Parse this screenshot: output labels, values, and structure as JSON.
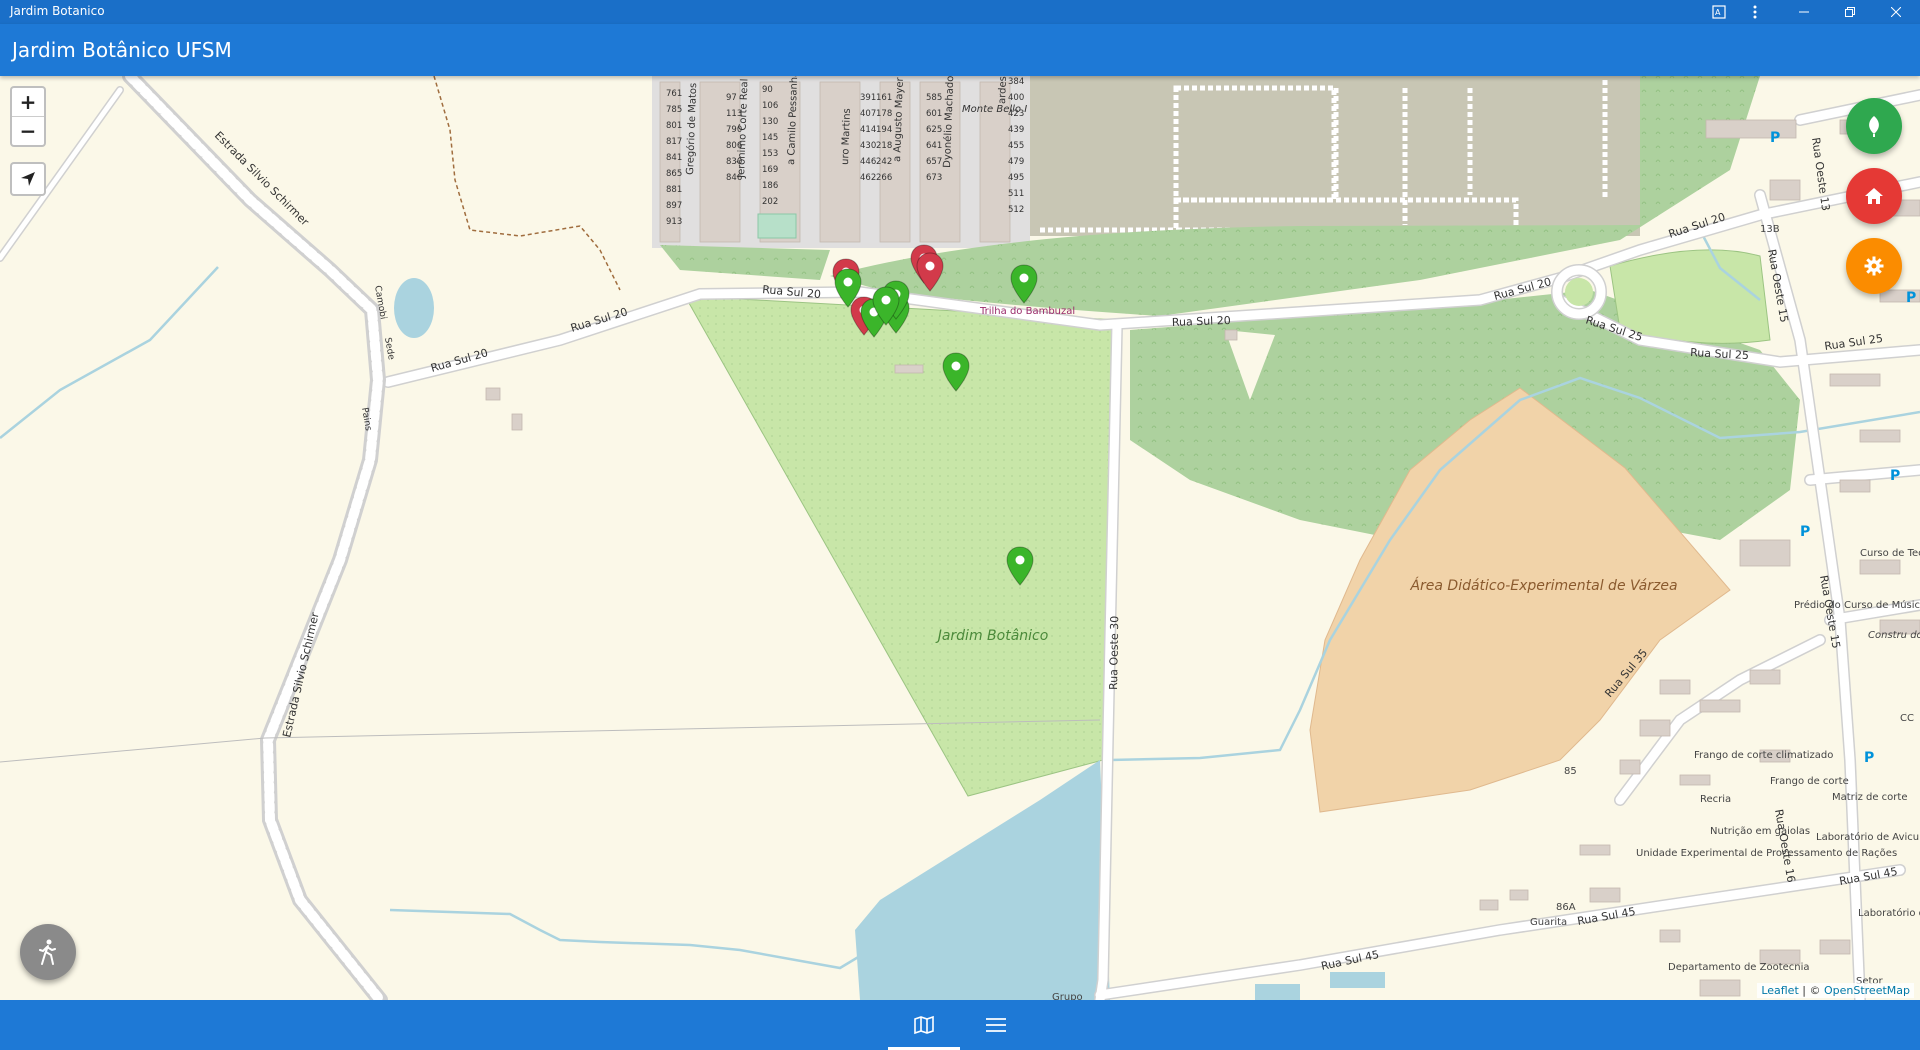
{
  "window": {
    "title": "Jardim Botanico",
    "buttons": [
      "translate-icon",
      "more-icon",
      "minimize-icon",
      "restore-icon",
      "close-icon"
    ]
  },
  "appbar": {
    "title": "Jardim Botânico UFSM"
  },
  "map": {
    "zoom_in": "+",
    "zoom_out": "−",
    "streets": {
      "rua_sul_20_a": "Rua Sul 20",
      "rua_sul_20_b": "Rua Sul 20",
      "rua_sul_20_c": "Rua Sul 20",
      "rua_sul_20_d": "Rua Sul 20",
      "rua_sul_20_e": "Rua Sul 20",
      "rua_sul_20_f": "Rua Sul 20",
      "rua_sul_25_a": "Rua Sul 25",
      "rua_sul_25_b": "Rua Sul 25",
      "rua_sul_25_c": "Rua Sul 25",
      "rua_sul_35": "Rua Sul 35",
      "rua_sul_45_a": "Rua Sul 45",
      "rua_sul_45_b": "Rua Sul 45",
      "rua_sul_45_c": "Rua Sul 45",
      "rua_oeste_30": "Rua Oeste 30",
      "rua_oeste_15_a": "Rua Oeste 15",
      "rua_oeste_15_b": "Rua Oeste 15",
      "rua_oeste_16": "Rua Oeste 16",
      "rua_oeste_13": "Rua Oeste 13",
      "estrada_a": "Estrada Silvio Schirmer",
      "estrada_b": "Estrada Silvio Schirmer",
      "camobi": "Camobi",
      "sede": "Sede",
      "pains": "Pains",
      "gregorio": "Gregório de Matos",
      "jeronimo": "Jerônimo Corte Real",
      "camilo": "a Camilo Pessanha",
      "martins": "uro Martins",
      "augusto": "a Augusto Mayer",
      "dyonelio": "Dyonélio Machado",
      "ardes": "ardes",
      "monte_belo": "Monte Bello I"
    },
    "places": {
      "jardim_botanico": "Jardim Botânico",
      "trilha": "Trilha do Bambuzal",
      "area_didatica": "Área Didático-Experimental de Várzea",
      "predio_musica": "Prédio do Curso de Música",
      "frango_climatizado": "Frango de corte climatizado",
      "recria": "Recria",
      "nutricao": "Nutrição em gaiolas",
      "frango_matriz": "Frango de corte",
      "matriz": "Matriz de corte",
      "lavic": "Laboratório de Avicultura - LAVIC",
      "unidade": "Unidade Experimental de Processamento de Rações",
      "lab_pesquisa": "Laboratório de Pesquisa e Desenvolvimento de Máquinas Agrícolas",
      "zootecnia": "Departamento de Zootecnia",
      "curso_tec": "Curso de Tecn em Alim",
      "construcao": "Constru do Laborat das Human",
      "guarita": "Guarita",
      "n86a": "86A",
      "n85": "85",
      "n13b": "13B",
      "grupo": "Grupo",
      "setor": "Setor",
      "cc": "CC"
    },
    "house_numbers_left": [
      "761",
      "785",
      "801",
      "817",
      "841",
      "865",
      "881",
      "897",
      "913"
    ],
    "house_numbers_col2": [
      "97",
      "113",
      "790",
      "806",
      "830",
      "846"
    ],
    "house_numbers_col3": [
      "90",
      "106",
      "130",
      "145",
      "153",
      "169",
      "186",
      "202"
    ],
    "house_numbers_col4": [
      "391",
      "407",
      "414",
      "430",
      "446",
      "462"
    ],
    "house_numbers_col5": [
      "161",
      "178",
      "194",
      "218",
      "242",
      "266"
    ],
    "house_numbers_col6": [
      "585",
      "601",
      "625",
      "641",
      "657",
      "673"
    ],
    "house_numbers_col7": [
      "384",
      "400",
      "423",
      "439",
      "455",
      "479",
      "495",
      "511",
      "512"
    ],
    "markers": {
      "green": 9,
      "red": 4
    },
    "attribution": {
      "leaflet": "Leaflet",
      "sep": " | © ",
      "osm": "OpenStreetMap"
    }
  },
  "fabs": {
    "plants": "leaf-icon",
    "home": "home-icon",
    "settings": "gear-icon"
  },
  "bottom_nav": [
    {
      "icon": "map-icon",
      "active": true
    },
    {
      "icon": "menu-icon",
      "active": false
    }
  ],
  "colors": {
    "appbar": "#1e79d6",
    "titlebar": "#1a6fc8",
    "fab_green": "#2fa84f",
    "fab_red": "#e53935",
    "fab_orange": "#fb8c00",
    "marker_green": "#3bb52a",
    "marker_red": "#d23a4a",
    "park": "#c8e6a8",
    "forest": "#add19e",
    "water": "#aad3df",
    "sand": "#f1d3a9"
  }
}
